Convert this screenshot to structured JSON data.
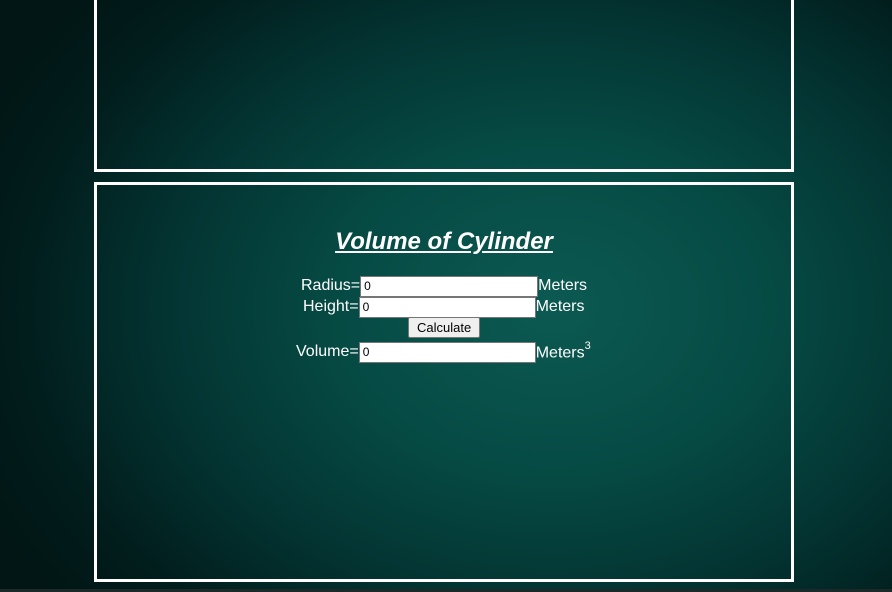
{
  "title": "Volume of Cylinder",
  "radius": {
    "label": "Radius=",
    "value": "0",
    "unit": "Meters"
  },
  "height": {
    "label": "Height=",
    "value": "0",
    "unit": "Meters"
  },
  "calculate_label": "Calculate",
  "volume": {
    "label": "Volume=",
    "value": "0",
    "unit": "Meters",
    "unit_exponent": "3"
  },
  "colors": {
    "border": "#ffffff",
    "background": "#064a44",
    "text": "#ffffff"
  }
}
